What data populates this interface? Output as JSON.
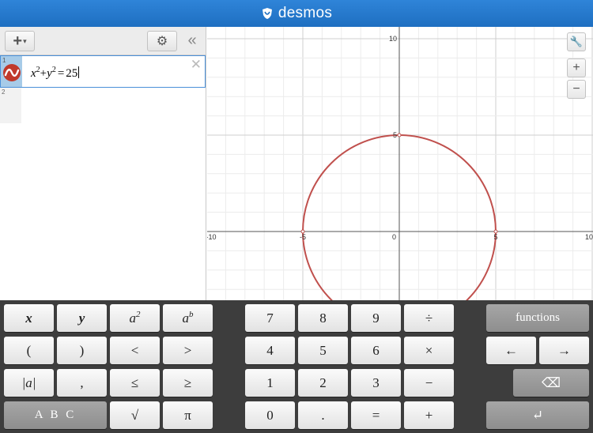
{
  "header": {
    "brand": "desmos",
    "logo_icon": "desmos-shield-icon"
  },
  "expression_panel": {
    "add_label": "+",
    "add_caret": "▾",
    "settings_icon": "⚙",
    "collapse_icon": "«",
    "close_label": "✕",
    "rows": [
      {
        "num": "1",
        "base_x": "x",
        "exp_x": "2",
        "plus": "+",
        "base_y": "y",
        "exp_y": "2",
        "eq": "=",
        "rhs": "25",
        "color": "#c0392b"
      },
      {
        "num": "2"
      }
    ]
  },
  "graph": {
    "wrench_icon": "🔧",
    "zoom_in": "+",
    "zoom_out": "−",
    "axis_labels": {
      "x_neg10": "-10",
      "x_neg5": "-5",
      "origin": "0",
      "x_5": "5",
      "x_10": "10",
      "y_10": "10",
      "y_5": "5"
    }
  },
  "chart_data": {
    "type": "line",
    "equation": "x^2+y^2=25",
    "series": [
      {
        "values": [
          [
            0,
            5
          ],
          [
            5,
            0
          ],
          [
            0,
            -5
          ],
          [
            -5,
            0
          ]
        ]
      }
    ],
    "xlim": [
      -10.5,
      10.5
    ],
    "ylim": [
      -7,
      10.5
    ],
    "grid": true,
    "color": "#c0504d"
  },
  "keypad": {
    "keys": {
      "x": "x",
      "y": "y",
      "a_base": "a",
      "sq_exp": "2",
      "ab_base": "a",
      "ab_exp": "b",
      "lparen": "(",
      "rparen": ")",
      "lt": "<",
      "gt": ">",
      "abs": "|a|",
      "comma": ",",
      "le": "≤",
      "ge": "≥",
      "abc": "A B C",
      "sqrt": "√",
      "pi": "π",
      "n7": "7",
      "n8": "8",
      "n9": "9",
      "div": "÷",
      "n4": "4",
      "n5": "5",
      "n6": "6",
      "mul": "×",
      "n1": "1",
      "n2": "2",
      "n3": "3",
      "minus": "−",
      "n0": "0",
      "dot": ".",
      "equals": "=",
      "plus": "+",
      "functions": "functions",
      "left": "←",
      "right": "→",
      "backspace": "⌫",
      "enter": "↵"
    }
  }
}
